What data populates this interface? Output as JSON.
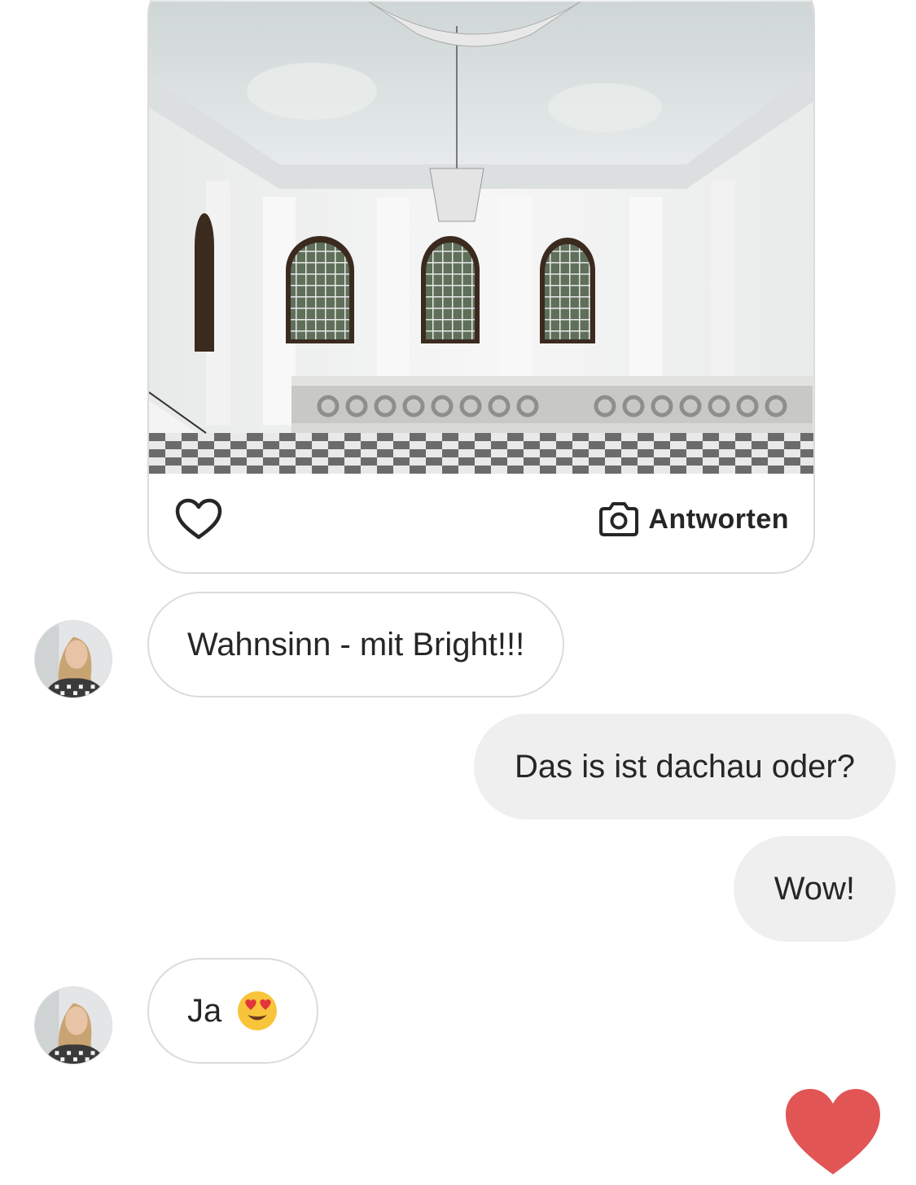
{
  "post": {
    "image_alt": "Weißer Barocksaal mit Kronleuchter, Bogenfenstern und Balustrade",
    "like_icon": "heart-outline-icon",
    "reply_icon": "camera-icon",
    "reply_label": "Antworten"
  },
  "messages": [
    {
      "side": "incoming",
      "text": "Wahnsinn - mit Bright!!!",
      "avatar": "profile-photo"
    },
    {
      "side": "outgoing",
      "text": "Das is ist dachau oder?"
    },
    {
      "side": "outgoing",
      "text": "Wow!"
    },
    {
      "side": "incoming",
      "text": "Ja",
      "emoji": "heart-eyes-emoji",
      "avatar": "profile-photo"
    }
  ],
  "reaction": {
    "icon": "heart-filled-icon",
    "color": "#e25555"
  },
  "colors": {
    "bubble_border": "#dbdbdb",
    "outgoing_bg": "#efefef",
    "text": "#262626"
  }
}
